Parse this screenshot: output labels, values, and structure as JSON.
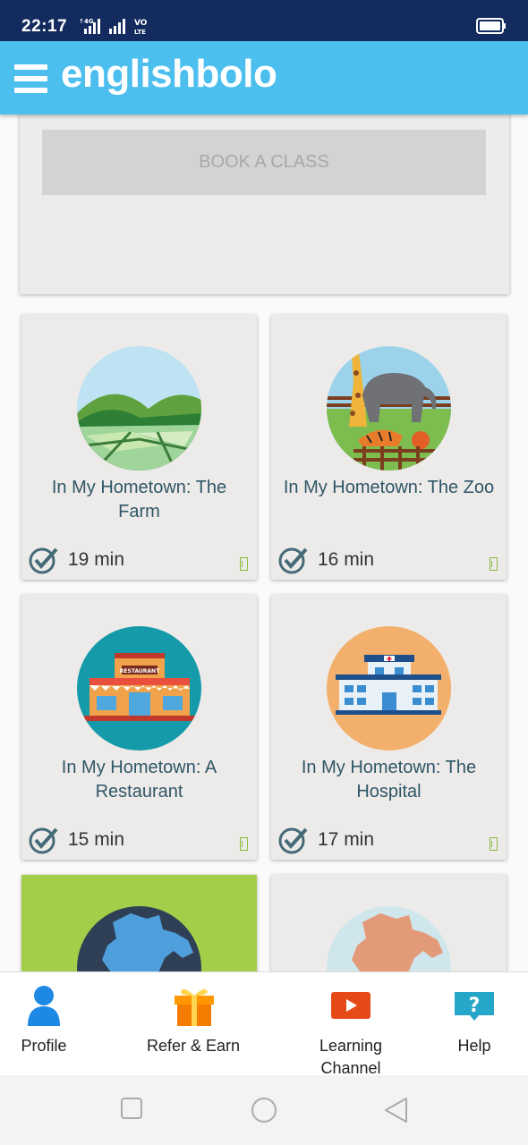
{
  "status_bar": {
    "time": "22:17",
    "network": "4G",
    "carrier_tag": "VoLTE"
  },
  "header": {
    "logo": "englishbolo",
    "menu_icon": "hamburger-menu-icon"
  },
  "book_class": {
    "label": "BOOK A CLASS"
  },
  "lessons": [
    {
      "title": "In My Hometown: The Farm",
      "duration": "19 min",
      "image": "farm"
    },
    {
      "title": "In My Hometown: The Zoo",
      "duration": "16 min",
      "image": "zoo"
    },
    {
      "title": "In My Hometown: A Restaurant",
      "duration": "15 min",
      "image": "restaurant",
      "sign": "RESTAURANT"
    },
    {
      "title": "In My Hometown: The Hospital",
      "duration": "17 min",
      "image": "hospital"
    },
    {
      "title": "",
      "duration": "",
      "image": "india-map-dark"
    },
    {
      "title": "",
      "duration": "",
      "image": "india-map-light"
    }
  ],
  "bottom_nav": [
    {
      "label": "Profile",
      "icon": "profile-icon",
      "color": "#1e88e5"
    },
    {
      "label": "Refer & Earn",
      "icon": "gift-icon",
      "color": "#f57c00"
    },
    {
      "label": "Learning Channel",
      "icon": "youtube-play-icon",
      "color": "#e64a19"
    },
    {
      "label": "Help",
      "icon": "help-chat-icon",
      "color": "#26a6c8"
    }
  ],
  "colors": {
    "status_bar": "#132b5e",
    "header": "#4dbfee",
    "card": "#edebe9",
    "card_green": "#a4cd4a",
    "title_text": "#2f5667"
  }
}
